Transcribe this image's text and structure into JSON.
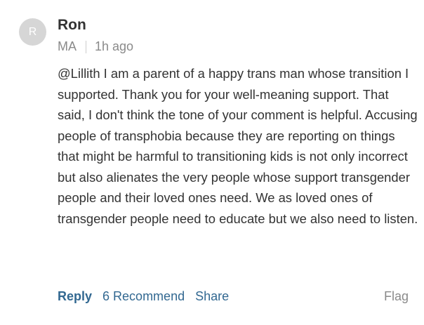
{
  "comment": {
    "avatar_initial": "R",
    "author": "Ron",
    "location": "MA",
    "time": "1h ago",
    "body": "@Lillith I am a parent of a happy trans man whose transition I supported.  Thank you for your well-meaning support.  That said, I don't think the tone of your comment is helpful.  Accusing people of transphobia because they are reporting on things that might be harmful to transitioning kids is not only incorrect but also alienates the very people whose support transgender people and their loved ones need.  We as loved ones of transgender people need to educate but we also need to listen."
  },
  "actions": {
    "reply_label": "Reply",
    "recommend_label": "6 Recommend",
    "share_label": "Share",
    "flag_label": "Flag"
  },
  "colors": {
    "link": "#326891",
    "muted": "#8a8a8a",
    "text": "#333333",
    "avatar_bg": "#d6d6d6"
  }
}
